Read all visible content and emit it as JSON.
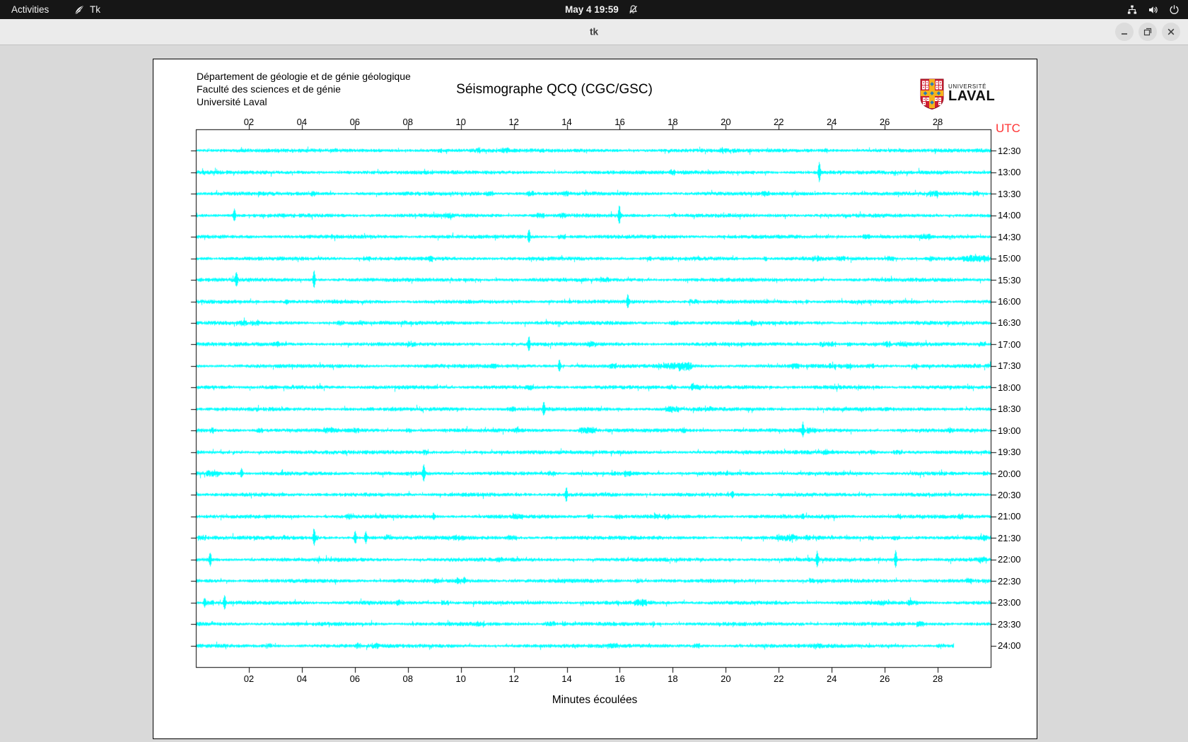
{
  "top_bar": {
    "activities": "Activities",
    "app_indicator": "Tk",
    "clock": "May 4 19:59"
  },
  "window": {
    "title": "tk"
  },
  "seismograph": {
    "header_lines": [
      "Département de géologie et de génie géologique",
      "Faculté des sciences et de génie",
      "Université Laval"
    ],
    "title": "Séismographe QCQ (CGC/GSC)",
    "logo": {
      "line1": "UNIVERSITÉ",
      "line2": "LAVAL"
    },
    "utc_label": "UTC",
    "x_label": "Minutes écoulées",
    "x_ticks": [
      "02",
      "04",
      "06",
      "08",
      "10",
      "12",
      "14",
      "16",
      "18",
      "20",
      "22",
      "24",
      "26",
      "28"
    ],
    "x_range_minutes": [
      0,
      30
    ],
    "colors": {
      "trace": "#00ffff",
      "utc": "#ff3333",
      "axis": "#000000"
    },
    "rows": [
      {
        "time": "12:30"
      },
      {
        "time": "13:00"
      },
      {
        "time": "13:30"
      },
      {
        "time": "14:00"
      },
      {
        "time": "14:30"
      },
      {
        "time": "15:00"
      },
      {
        "time": "15:30"
      },
      {
        "time": "16:00"
      },
      {
        "time": "16:30"
      },
      {
        "time": "17:00"
      },
      {
        "time": "17:30"
      },
      {
        "time": "18:00"
      },
      {
        "time": "18:30"
      },
      {
        "time": "19:00"
      },
      {
        "time": "19:30"
      },
      {
        "time": "20:00"
      },
      {
        "time": "20:30"
      },
      {
        "time": "21:00"
      },
      {
        "time": "21:30"
      },
      {
        "time": "22:00"
      },
      {
        "time": "22:30"
      },
      {
        "time": "23:00"
      },
      {
        "time": "23:30"
      },
      {
        "time": "24:00",
        "end_minute": 28.6
      }
    ],
    "events": [
      {
        "row": 1,
        "minute": 23.52,
        "amp": 14
      },
      {
        "row": 3,
        "minute": 1.44,
        "amp": 8
      },
      {
        "row": 3,
        "minute": 15.97,
        "amp": 13
      },
      {
        "row": 4,
        "minute": 12.56,
        "amp": 9
      },
      {
        "row": 6,
        "minute": 1.52,
        "amp": 10
      },
      {
        "row": 6,
        "minute": 4.45,
        "amp": 12
      },
      {
        "row": 7,
        "minute": 16.29,
        "amp": 9
      },
      {
        "row": 9,
        "minute": 12.56,
        "amp": 10
      },
      {
        "row": 10,
        "minute": 13.71,
        "amp": 8
      },
      {
        "row": 11,
        "minute": 18.72,
        "amp": 4
      },
      {
        "row": 12,
        "minute": 13.12,
        "amp": 9
      },
      {
        "row": 13,
        "minute": 22.9,
        "amp": 10
      },
      {
        "row": 15,
        "minute": 1.71,
        "amp": 6
      },
      {
        "row": 15,
        "minute": 8.59,
        "amp": 11
      },
      {
        "row": 16,
        "minute": 13.97,
        "amp": 9
      },
      {
        "row": 16,
        "minute": 20.24,
        "amp": 4
      },
      {
        "row": 17,
        "minute": 8.96,
        "amp": 4
      },
      {
        "row": 18,
        "minute": 4.45,
        "amp": 9
      },
      {
        "row": 18,
        "minute": 6.0,
        "amp": 8
      },
      {
        "row": 18,
        "minute": 6.4,
        "amp": 8
      },
      {
        "row": 19,
        "minute": 0.53,
        "amp": 9
      },
      {
        "row": 19,
        "minute": 23.44,
        "amp": 10
      },
      {
        "row": 19,
        "minute": 26.4,
        "amp": 12
      },
      {
        "row": 20,
        "minute": 9.87,
        "amp": 3.5
      },
      {
        "row": 20,
        "minute": 10.12,
        "amp": 3.5
      },
      {
        "row": 21,
        "minute": 0.32,
        "amp": 6
      },
      {
        "row": 21,
        "minute": 1.07,
        "amp": 10
      }
    ],
    "bursts": [
      {
        "row": 5,
        "minute": 29.4,
        "width_min": 1.0,
        "amp": 3
      },
      {
        "row": 9,
        "minute": 23.84,
        "width_min": 0.6,
        "amp": 3
      },
      {
        "row": 10,
        "minute": 18.1,
        "width_min": 1.3,
        "amp": 3
      },
      {
        "row": 12,
        "minute": 17.97,
        "width_min": 0.5,
        "amp": 3
      },
      {
        "row": 13,
        "minute": 14.77,
        "width_min": 0.7,
        "amp": 3
      },
      {
        "row": 15,
        "minute": 0.64,
        "width_min": 0.5,
        "amp": 3
      },
      {
        "row": 18,
        "minute": 22.3,
        "width_min": 0.8,
        "amp": 3
      },
      {
        "row": 21,
        "minute": 16.77,
        "width_min": 0.5,
        "amp": 3
      }
    ]
  }
}
